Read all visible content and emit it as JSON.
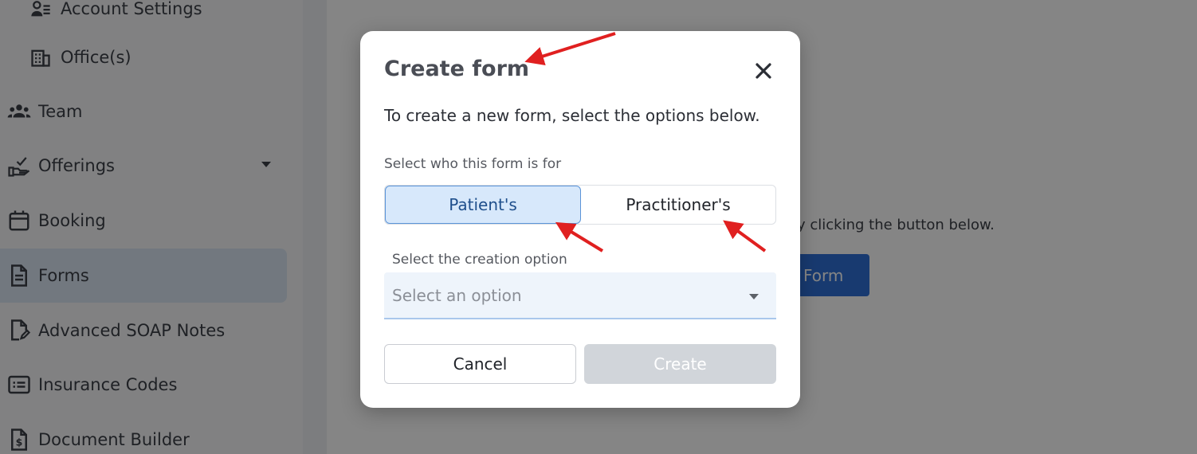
{
  "sidebar": {
    "account_settings": "Account Settings",
    "offices": "Office(s)",
    "items": [
      {
        "label": "Team",
        "icon": "team-icon"
      },
      {
        "label": "Offerings",
        "icon": "hand-offering-icon"
      },
      {
        "label": "Booking",
        "icon": "calendar-icon"
      },
      {
        "label": "Forms",
        "icon": "document-icon"
      },
      {
        "label": "Advanced SOAP Notes",
        "icon": "edit-document-icon"
      },
      {
        "label": "Insurance Codes",
        "icon": "list-card-icon"
      },
      {
        "label": "Document Builder",
        "icon": "dollar-document-icon"
      }
    ],
    "active_item": "Forms"
  },
  "background": {
    "hint_text": "y clicking the button below.",
    "button_label": "Form"
  },
  "modal": {
    "title": "Create form",
    "description": "To create a new form, select the options below.",
    "who_label": "Select who this form is for",
    "options": [
      "Patient's",
      "Practitioner's"
    ],
    "selected_option": "Patient's",
    "creation_label": "Select the creation option",
    "select_placeholder": "Select an option",
    "cancel_label": "Cancel",
    "create_label": "Create"
  },
  "colors": {
    "accent": "#2f6fd6",
    "selected_bg": "#d7e8fb",
    "annotation_arrow": "#e02020",
    "disabled_button": "#d1d5da"
  }
}
